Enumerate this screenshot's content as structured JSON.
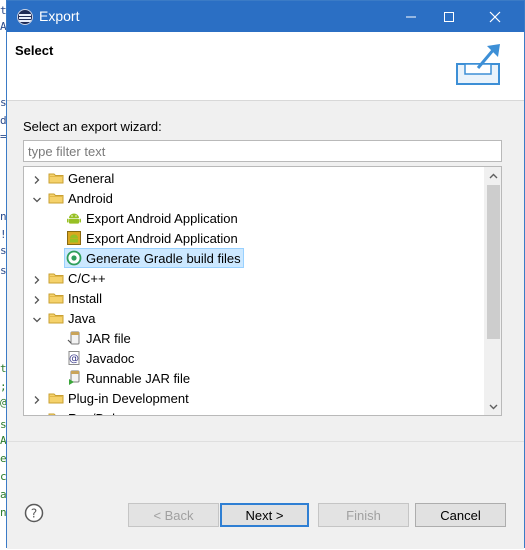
{
  "window": {
    "title": "Export"
  },
  "background_editor_chars": [
    "t",
    "A",
    "s",
    "d",
    "=",
    "n",
    "!",
    "s",
    "s",
    "t",
    ";",
    "@",
    "s",
    "A",
    "e",
    "c",
    "a",
    "n"
  ],
  "header": {
    "title": "Select"
  },
  "wizard": {
    "prompt": "Select an export wizard:",
    "filter_placeholder": "type filter text",
    "filter_value": ""
  },
  "tree": {
    "items": [
      {
        "label": "General",
        "level": 0,
        "kind": "folder",
        "expanded": false
      },
      {
        "label": "Android",
        "level": 0,
        "kind": "folder",
        "expanded": true
      },
      {
        "label": "Export Android Application",
        "level": 1,
        "kind": "android-icon"
      },
      {
        "label": "Export Android Application",
        "level": 1,
        "kind": "android-package-icon"
      },
      {
        "label": "Generate Gradle build files",
        "level": 1,
        "kind": "gradle-icon",
        "selected": true
      },
      {
        "label": "C/C++",
        "level": 0,
        "kind": "folder",
        "expanded": false
      },
      {
        "label": "Install",
        "level": 0,
        "kind": "folder",
        "expanded": false
      },
      {
        "label": "Java",
        "level": 0,
        "kind": "folder",
        "expanded": true
      },
      {
        "label": "JAR file",
        "level": 1,
        "kind": "jar-icon"
      },
      {
        "label": "Javadoc",
        "level": 1,
        "kind": "javadoc-icon"
      },
      {
        "label": "Runnable JAR file",
        "level": 1,
        "kind": "runnable-jar-icon"
      },
      {
        "label": "Plug-in Development",
        "level": 0,
        "kind": "folder",
        "expanded": false
      },
      {
        "label": "Run/Debug",
        "level": 0,
        "kind": "folder",
        "expanded": false
      }
    ],
    "scroll_position": 0.0,
    "scroll_visible_fraction": 0.72
  },
  "buttons": {
    "back": "< Back",
    "next": "Next >",
    "finish": "Finish",
    "cancel": "Cancel"
  },
  "colors": {
    "titlebar": "#2b6fc4",
    "selection": "#cce8ff",
    "default_button_border": "#2f7fd3"
  }
}
